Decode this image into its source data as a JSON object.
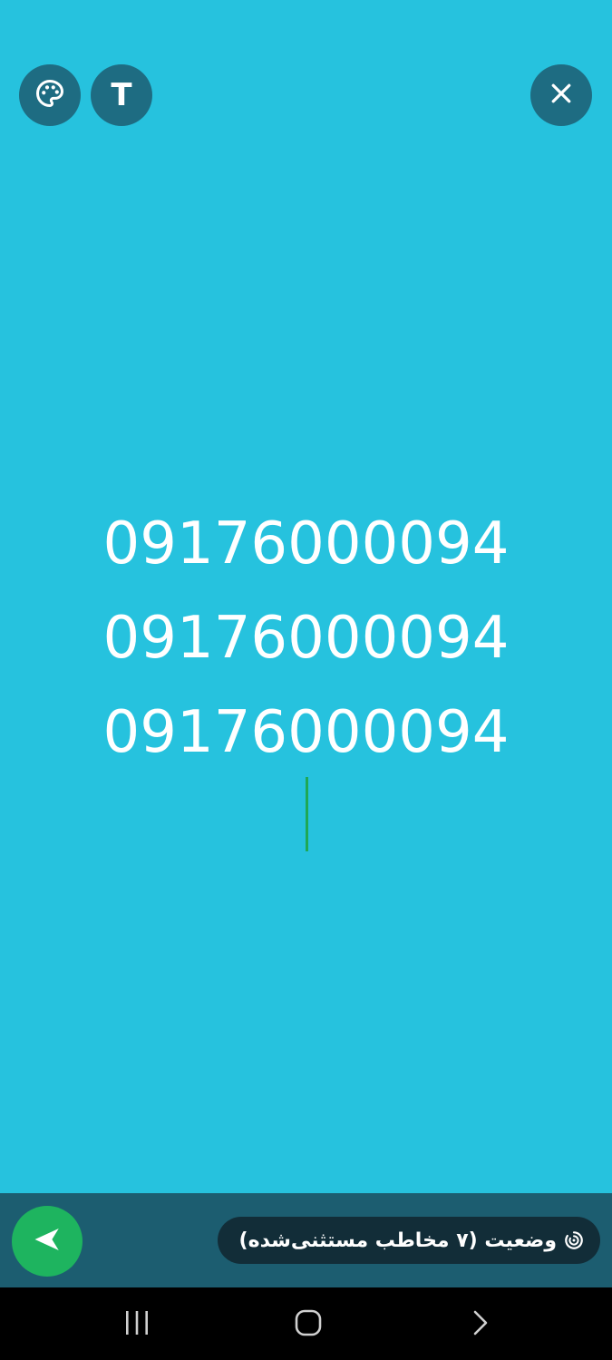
{
  "editor": {
    "text_lines": [
      "09176000094",
      "09176000094",
      "09176000094"
    ],
    "background_color": "#26C2DE",
    "text_color": "#FFFFFF",
    "cursor_color": "#1FA855"
  },
  "toolbar": {
    "palette_icon": "palette-icon",
    "text_tool_glyph": "T",
    "close_icon": "close-icon"
  },
  "footer": {
    "status_label": "وضعیت (۷ مخاطب مستثنی‌شده)",
    "status_icon": "status-privacy-icon",
    "send_icon": "send-icon"
  },
  "system_nav": {
    "recents_icon": "recents-icon",
    "home_icon": "home-icon",
    "back_icon": "back-icon"
  }
}
